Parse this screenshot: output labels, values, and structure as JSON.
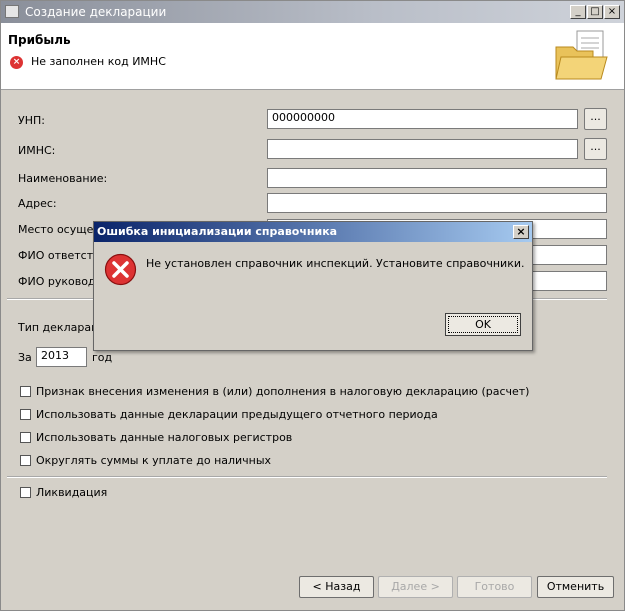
{
  "window": {
    "title": "Создание декларации",
    "controls": {
      "minimize": "_",
      "maximize": "□",
      "close": "×"
    }
  },
  "header": {
    "title": "Прибыль",
    "error": "Не заполнен код ИМНС",
    "icon": "folder-document-icon"
  },
  "form": {
    "unp": {
      "label": "УНП:",
      "value": "000000000",
      "browse": "..."
    },
    "imns": {
      "label": "ИМНС:",
      "value": "",
      "browse": "..."
    },
    "name_label": "Наименование:",
    "address_label": "Адрес:",
    "place_label": "Место осуществ",
    "fio_resp_label": "ФИО ответстве",
    "fio_head_label": "ФИО руководи",
    "decl_type_label": "Тип декларации",
    "year_prefix": "За",
    "year_value": "2013",
    "year_suffix": "год"
  },
  "checkboxes": [
    {
      "label": "Признак внесения изменения в (или) дополнения в налоговую декларацию (расчет)",
      "checked": false
    },
    {
      "label": "Использовать данные декларации предыдущего отчетного периода",
      "checked": false
    },
    {
      "label": "Использовать данные налоговых регистров",
      "checked": false
    },
    {
      "label": "Округлять суммы к уплате до наличных",
      "checked": false
    }
  ],
  "liquidation": {
    "label": "Ликвидация",
    "checked": false
  },
  "buttons": {
    "back": "< Назад",
    "next": "Далее >",
    "finish": "Готово",
    "cancel": "Отменить"
  },
  "dialog": {
    "title": "Ошибка инициализации справочника",
    "close": "×",
    "message": "Не установлен справочник инспекций. Установите справочники.",
    "ok": "OK",
    "icon": "error-icon"
  },
  "colors": {
    "dialog_title_start": "#0a246a",
    "dialog_title_end": "#a6caf0",
    "error_red": "#d33",
    "window_bg": "#d4d0c8"
  }
}
